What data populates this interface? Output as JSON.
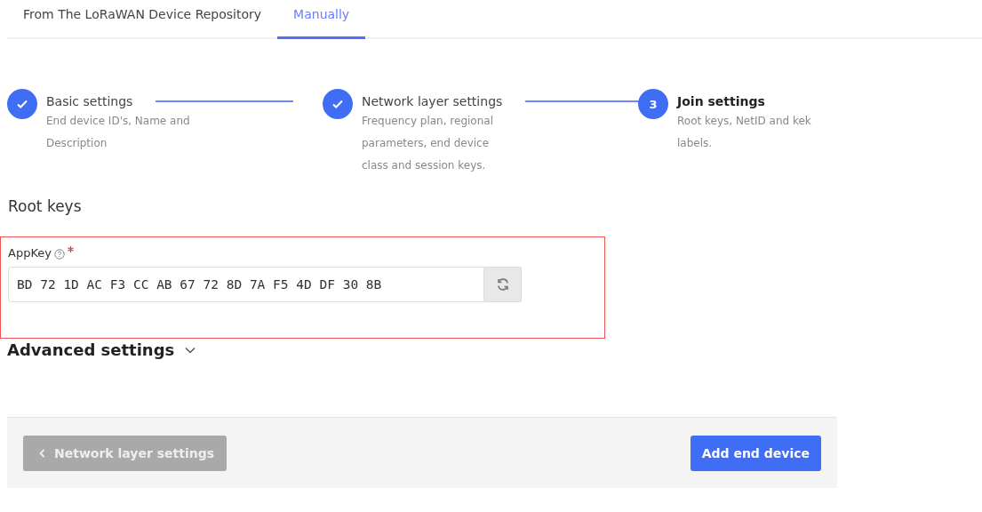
{
  "tabs": [
    {
      "label": "From The LoRaWAN Device Repository",
      "selected": false
    },
    {
      "label": "Manually",
      "selected": true
    }
  ],
  "steps": [
    {
      "completed": true,
      "title": "Basic settings",
      "description": "End device ID's, Name and Description"
    },
    {
      "completed": true,
      "title": "Network layer settings",
      "description": "Frequency plan, regional parameters, end device class and session keys."
    },
    {
      "completed": false,
      "number": "3",
      "title": "Join settings",
      "description": "Root keys, NetID and kek labels."
    }
  ],
  "section_title": "Root keys",
  "appkey_field": {
    "label": "AppKey",
    "required": true,
    "highlighted": true,
    "value": "BD 72 1D AC F3 CC AB 67 72 8D 7A F5 4D DF 30 8B"
  },
  "advanced_settings": {
    "label": "Advanced settings",
    "expanded": false
  },
  "footer": {
    "back_button": {
      "label": "Network layer settings",
      "disabled": true
    },
    "submit_button": {
      "label": "Add end device"
    }
  }
}
